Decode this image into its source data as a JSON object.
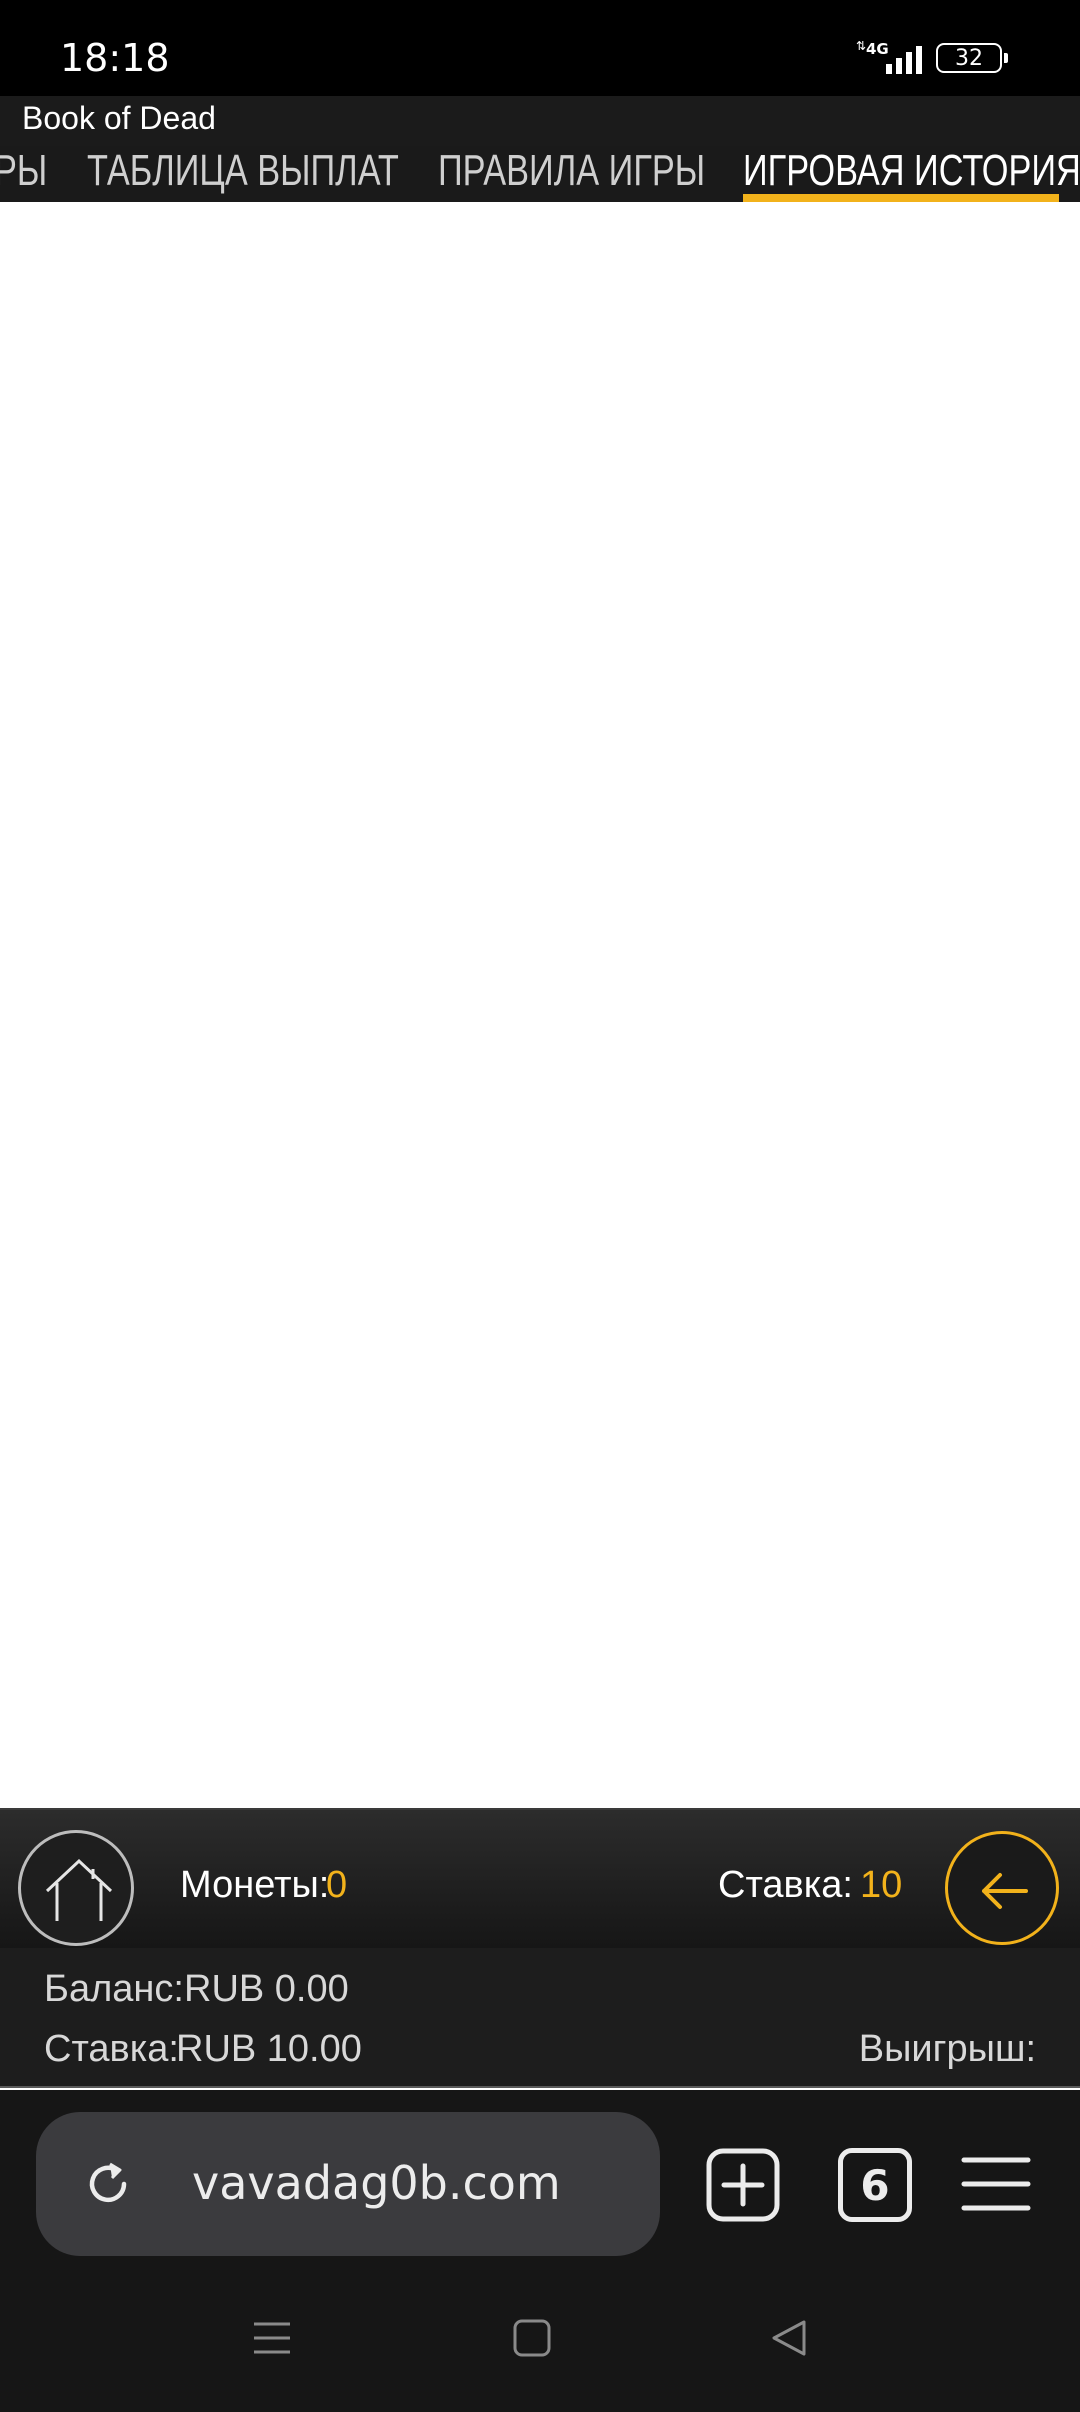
{
  "status_bar": {
    "time": "18:18",
    "network": "4G",
    "battery": "32"
  },
  "game": {
    "title": "Book of Dead",
    "tabs": [
      {
        "label": "РЫ",
        "active": false
      },
      {
        "label": "ТАБЛИЦА ВЫПЛАТ",
        "active": false
      },
      {
        "label": "ПРАВИЛА ИГРЫ",
        "active": false
      },
      {
        "label": "ИГРОВАЯ ИСТОРИЯ",
        "active": true
      }
    ],
    "accent_color": "#f2b21b"
  },
  "game_bar": {
    "coins_label": "Монеты:",
    "coins_value": "0",
    "bet_label": "Ставка:",
    "bet_value": "10",
    "home_icon": "home-icon",
    "back_icon": "arrow-left-icon"
  },
  "balance": {
    "balance_label": "Баланс:",
    "balance_value": "RUB 0.00",
    "stake_label": "Ставка:",
    "stake_value": "RUB 10.00",
    "win_label": "Выигрыш:"
  },
  "browser": {
    "url": "vavadag0b.com",
    "tab_count": "6"
  }
}
